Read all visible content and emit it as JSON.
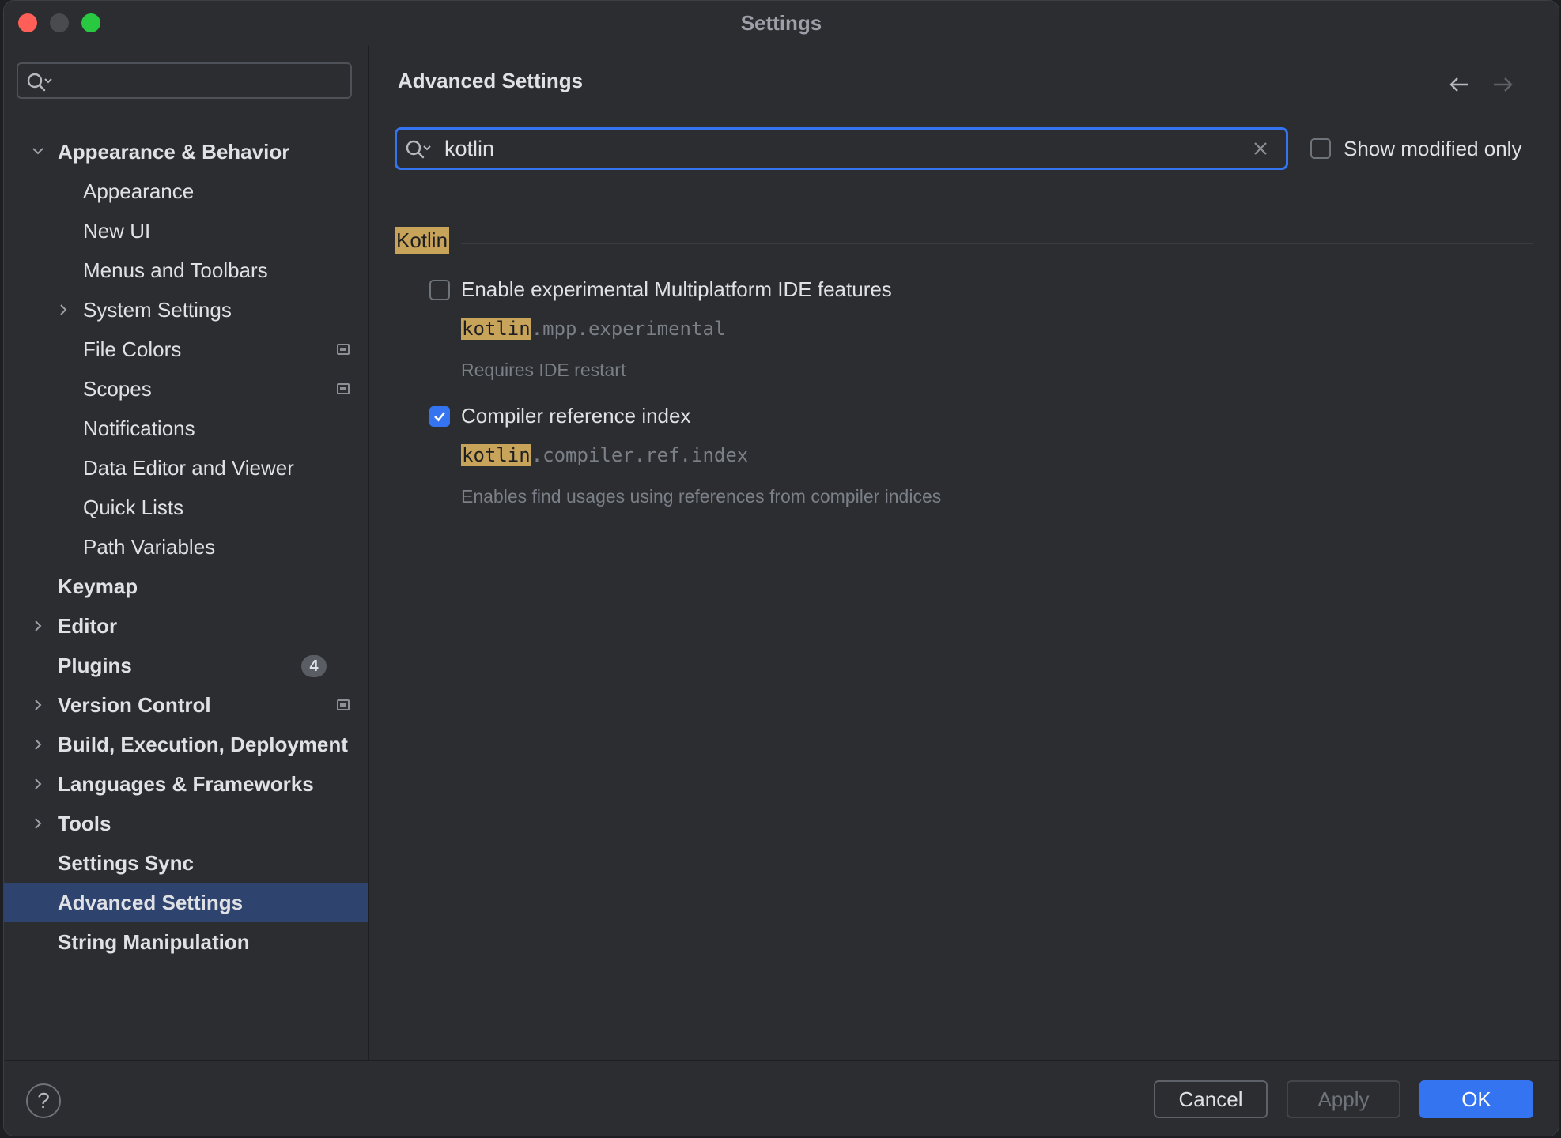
{
  "window": {
    "title": "Settings"
  },
  "sidebar": {
    "search": {
      "value": ""
    },
    "items": [
      {
        "label": "Appearance & Behavior",
        "level": 0,
        "chevron": "down"
      },
      {
        "label": "Appearance",
        "level": 1
      },
      {
        "label": "New UI",
        "level": 1
      },
      {
        "label": "Menus and Toolbars",
        "level": 1
      },
      {
        "label": "System Settings",
        "level": 1,
        "chevron": "right"
      },
      {
        "label": "File Colors",
        "level": 1,
        "project_icon": true
      },
      {
        "label": "Scopes",
        "level": 1,
        "project_icon": true
      },
      {
        "label": "Notifications",
        "level": 1
      },
      {
        "label": "Data Editor and Viewer",
        "level": 1
      },
      {
        "label": "Quick Lists",
        "level": 1
      },
      {
        "label": "Path Variables",
        "level": 1
      },
      {
        "label": "Keymap",
        "level": 0
      },
      {
        "label": "Editor",
        "level": 0,
        "chevron": "right"
      },
      {
        "label": "Plugins",
        "level": 0,
        "badge": "4"
      },
      {
        "label": "Version Control",
        "level": 0,
        "chevron": "right",
        "project_icon": true
      },
      {
        "label": "Build, Execution, Deployment",
        "level": 0,
        "chevron": "right"
      },
      {
        "label": "Languages & Frameworks",
        "level": 0,
        "chevron": "right"
      },
      {
        "label": "Tools",
        "level": 0,
        "chevron": "right"
      },
      {
        "label": "Settings Sync",
        "level": 0
      },
      {
        "label": "Advanced Settings",
        "level": 0,
        "selected": true
      },
      {
        "label": "String Manipulation",
        "level": 0
      }
    ]
  },
  "main": {
    "title": "Advanced Settings",
    "search": {
      "value": "kotlin"
    },
    "show_modified_label": "Show modified only",
    "show_modified_checked": false,
    "group": {
      "title": "Kotlin",
      "settings": [
        {
          "label": "Enable experimental Multiplatform IDE features",
          "checked": false,
          "key_highlight": "kotlin",
          "key_rest": ".mpp.experimental",
          "description": "Requires IDE restart"
        },
        {
          "label": "Compiler reference index",
          "checked": true,
          "key_highlight": "kotlin",
          "key_rest": ".compiler.ref.index",
          "description": "Enables find usages using references from compiler indices"
        }
      ]
    }
  },
  "footer": {
    "help_label": "?",
    "cancel_label": "Cancel",
    "apply_label": "Apply",
    "ok_label": "OK"
  },
  "colors": {
    "accent": "#3574f0",
    "highlight": "#c8a45a",
    "selection": "#2e436e",
    "background": "#2b2d30"
  }
}
